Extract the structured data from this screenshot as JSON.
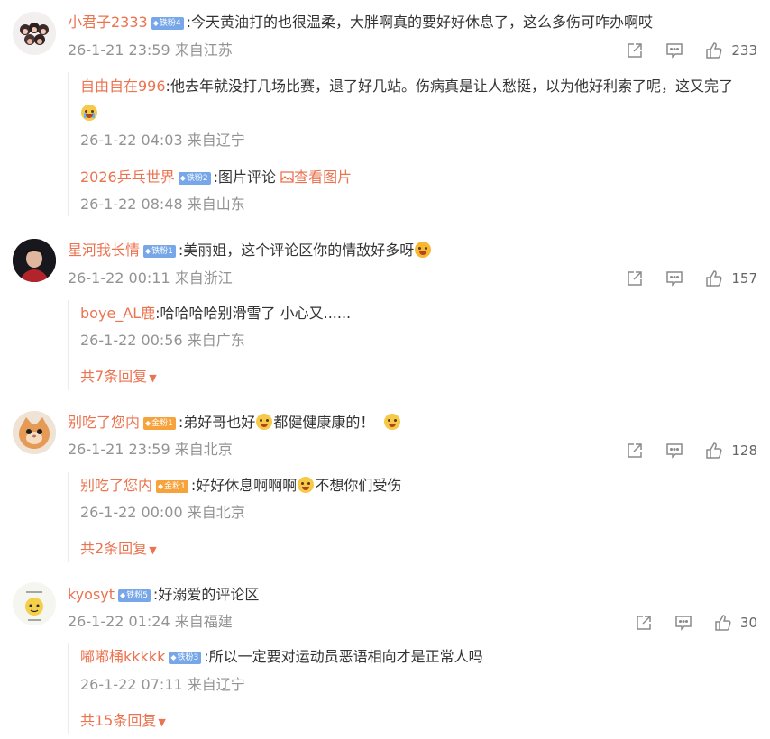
{
  "comments": [
    {
      "user": "小君子2333",
      "badge": "铁粉4",
      "text": ":今天黄油打的也很温柔，大胖啊真的要好好休息了，这么多伤可咋办啊哎",
      "meta": "26-1-21 23:59 来自江苏",
      "likes": "233",
      "replies": [
        {
          "user": "自由自在996",
          "text": ":他去年就没打几场比赛，退了好几站。伤病真是让人愁挺，以为他好利索了呢，这又完了",
          "meta": "26-1-22 04:03 来自辽宁"
        },
        {
          "user": "2026乒乓世界",
          "badge": "铁粉2",
          "text": ":图片评论",
          "link_text": "查看图片",
          "meta": "26-1-22 08:48 来自山东"
        }
      ]
    },
    {
      "user": "星河我长情",
      "badge": "铁粉1",
      "text": ":美丽姐，这个评论区你的情敌好多呀",
      "meta": "26-1-22 00:11 来自浙江",
      "likes": "157",
      "replies": [
        {
          "user": "boye_AL鹿",
          "text": ":哈哈哈哈别滑雪了 小心又......",
          "meta": "26-1-22 00:56 来自广东"
        }
      ],
      "more": "共7条回复"
    },
    {
      "user": "别吃了您内",
      "badge": "金粉1",
      "text": ":弟好哥也好",
      "text2": "都健健康康的！",
      "meta": "26-1-21 23:59 来自北京",
      "likes": "128",
      "replies": [
        {
          "user": "别吃了您内",
          "badge": "金粉1",
          "text": ":好好休息啊啊啊",
          "text2": "不想你们受伤",
          "meta": "26-1-22 00:00 来自北京"
        }
      ],
      "more": "共2条回复"
    },
    {
      "user": "kyosyt",
      "badge": "铁粉5",
      "text": ":好溺爱的评论区",
      "meta": "26-1-22 01:24 来自福建",
      "likes": "30",
      "replies": [
        {
          "user": "嘟嘟桶kkkkk",
          "badge": "铁粉3",
          "text": ":所以一定要对运动员恶语相向才是正常人吗",
          "meta": "26-1-22 07:11 来自辽宁"
        }
      ],
      "more": "共15条回复"
    }
  ],
  "icons": {
    "share": "share-icon",
    "comment": "comment-icon",
    "like": "like-icon",
    "image": "image-icon",
    "caret": "caret-down-icon"
  },
  "colors": {
    "username": "#eb7350",
    "meta": "#939393",
    "iron_badge": "#77a7e8",
    "gold_badge": "#f7a23a"
  }
}
